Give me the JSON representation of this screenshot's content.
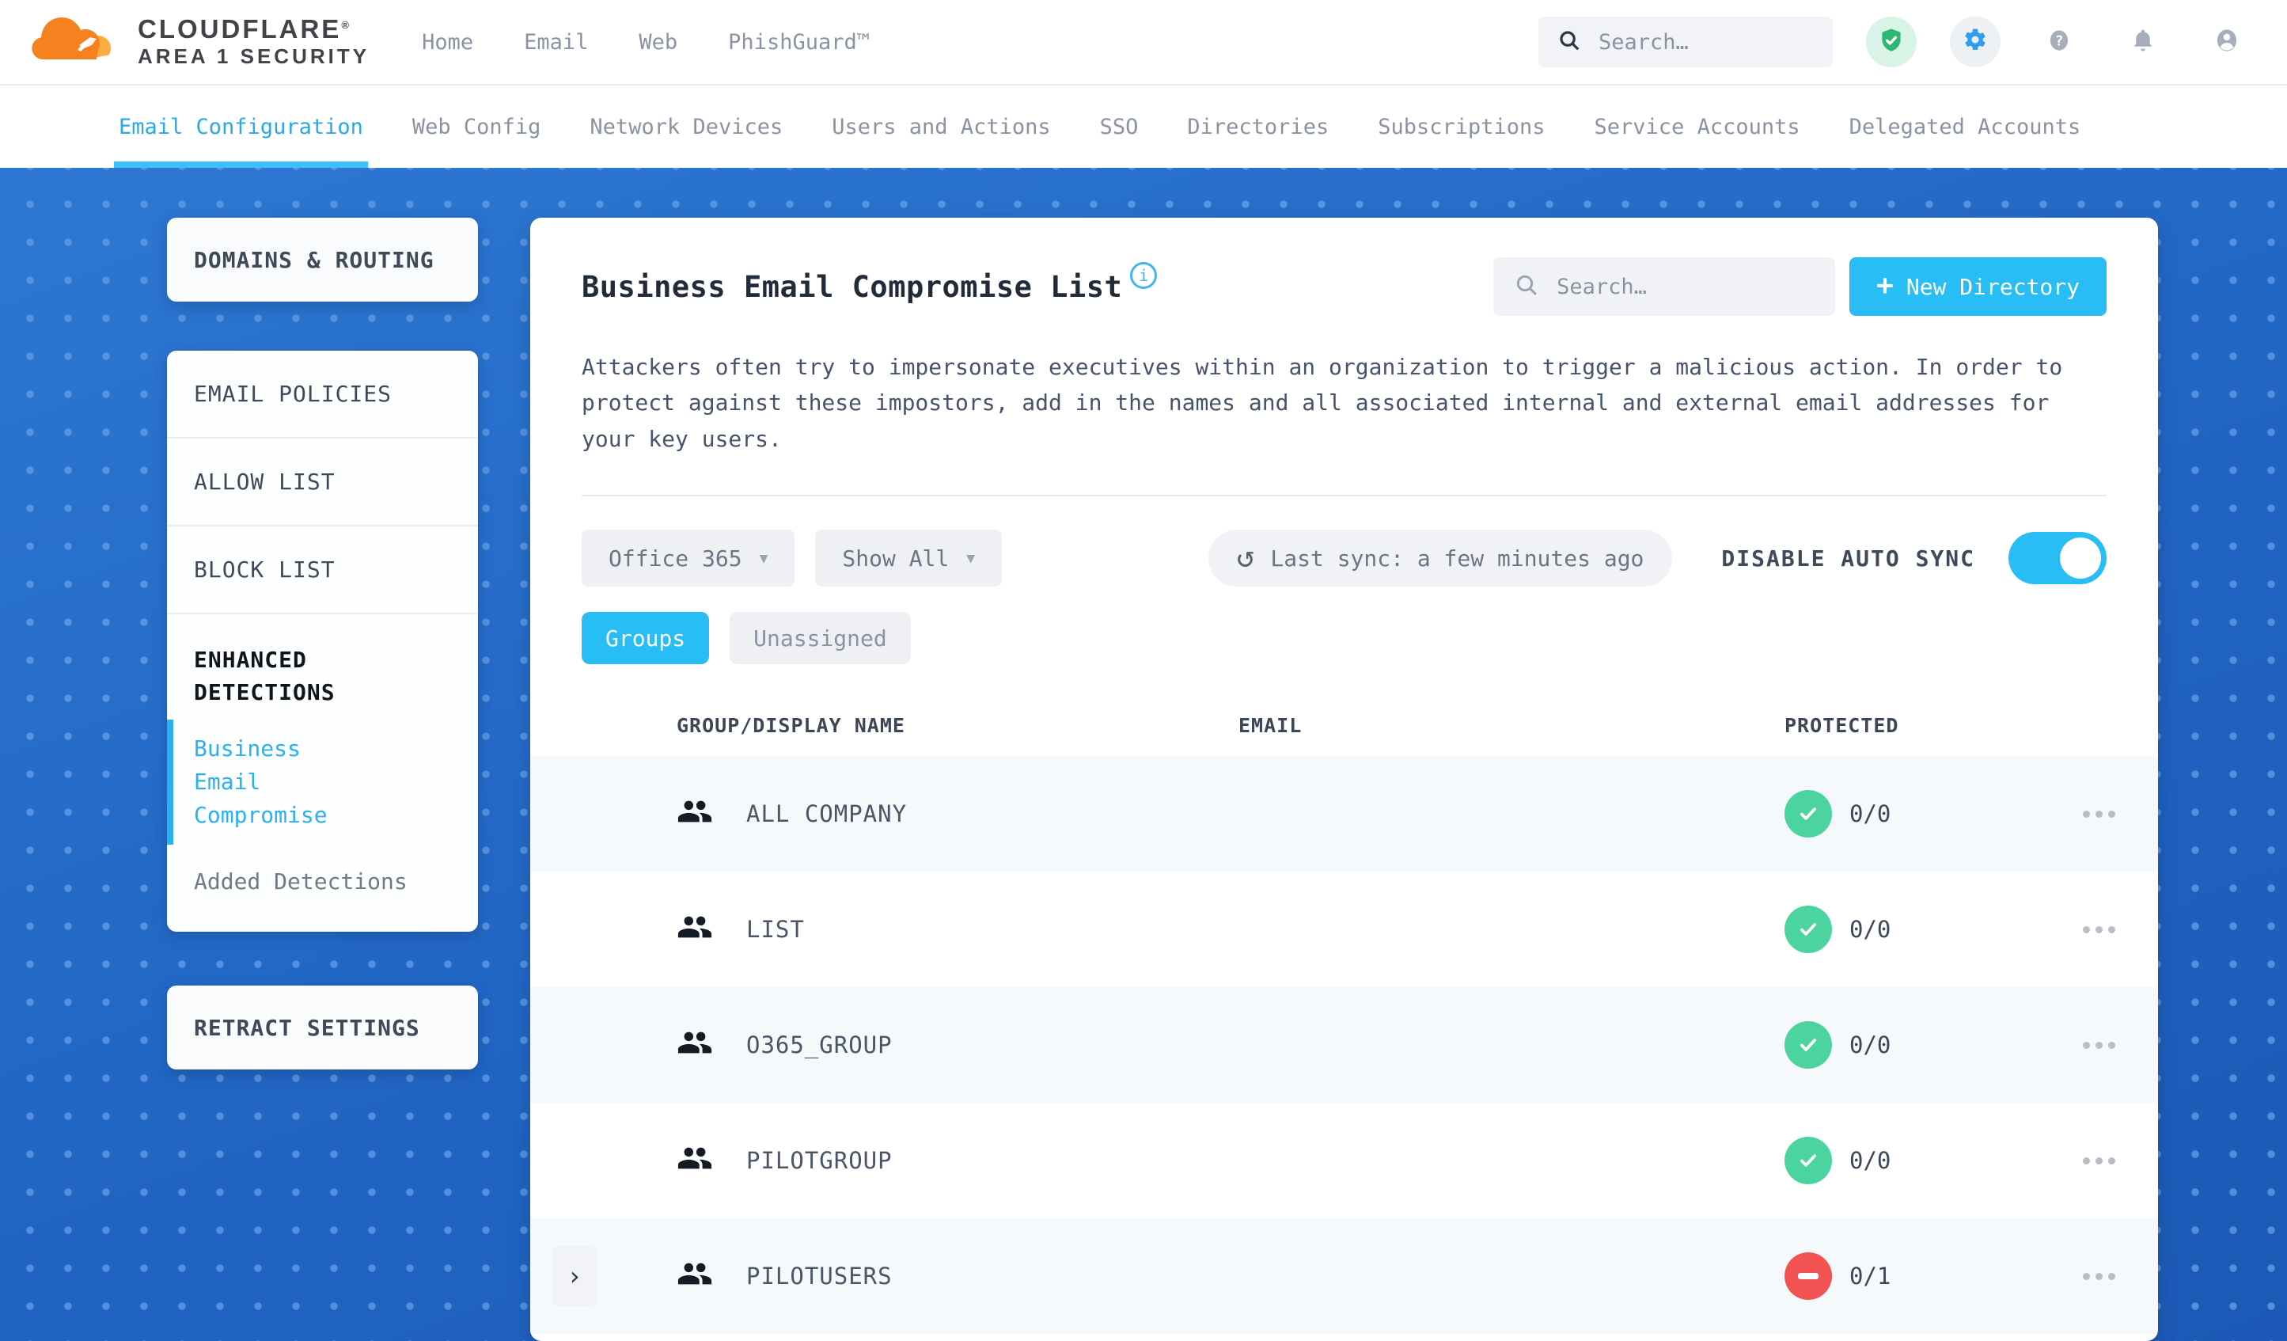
{
  "header": {
    "brand": "CLOUDFLARE",
    "brand_mark": "®",
    "brand_sub": "AREA 1 SECURITY",
    "nav": [
      "Home",
      "Email",
      "Web",
      "PhishGuard™"
    ],
    "search_placeholder": "Search…"
  },
  "tabs": [
    {
      "label": "Email Configuration",
      "active": true
    },
    {
      "label": "Web Config",
      "active": false
    },
    {
      "label": "Network Devices",
      "active": false
    },
    {
      "label": "Users and Actions",
      "active": false
    },
    {
      "label": "SSO",
      "active": false
    },
    {
      "label": "Directories",
      "active": false
    },
    {
      "label": "Subscriptions",
      "active": false
    },
    {
      "label": "Service Accounts",
      "active": false
    },
    {
      "label": "Delegated Accounts",
      "active": false
    }
  ],
  "sidebar": {
    "domains_routing": "DOMAINS & ROUTING",
    "policies": [
      "EMAIL POLICIES",
      "ALLOW LIST",
      "BLOCK LIST"
    ],
    "enhanced_detections": "ENHANCED DETECTIONS",
    "enhanced_items": [
      {
        "label": "Business Email Compromise",
        "active": true
      },
      {
        "label": "Added Detections",
        "active": false
      }
    ],
    "retract_settings": "RETRACT SETTINGS"
  },
  "main": {
    "title": "Business Email Compromise List",
    "info_icon": "i",
    "search_placeholder": "Search…",
    "new_directory_plus": "+",
    "new_directory": "New Directory",
    "description": "Attackers often try to impersonate executives within an organization to trigger a malicious action. In order to protect against these impostors, add in the names and all associated internal and external email addresses for your key users.",
    "directory_filter": "Office 365",
    "show_filter": "Show All",
    "last_sync": "Last sync: a few minutes ago",
    "auto_sync_label": "DISABLE AUTO SYNC",
    "auto_sync_enabled": true,
    "view_tabs": [
      {
        "label": "Groups",
        "active": true
      },
      {
        "label": "Unassigned",
        "active": false
      }
    ],
    "table": {
      "columns": [
        "GROUP/DISPLAY NAME",
        "EMAIL",
        "PROTECTED"
      ],
      "rows": [
        {
          "name": "ALL COMPANY",
          "email": "",
          "protected": "0/0",
          "status": "protected",
          "expandable": false
        },
        {
          "name": "LIST",
          "email": "",
          "protected": "0/0",
          "status": "protected",
          "expandable": false
        },
        {
          "name": "O365_GROUP",
          "email": "",
          "protected": "0/0",
          "status": "protected",
          "expandable": false
        },
        {
          "name": "PILOTGROUP",
          "email": "",
          "protected": "0/0",
          "status": "protected",
          "expandable": false
        },
        {
          "name": "PILOTUSERS",
          "email": "",
          "protected": "0/1",
          "status": "not_protected",
          "expandable": true
        }
      ]
    }
  },
  "colors": {
    "accent_blue": "#29bdf6",
    "background_blue": "#2164c4",
    "success_green": "#4bd4a0",
    "danger_red": "#f25352",
    "logo_orange": "#f6821f",
    "logo_light_orange": "#fbad41"
  }
}
